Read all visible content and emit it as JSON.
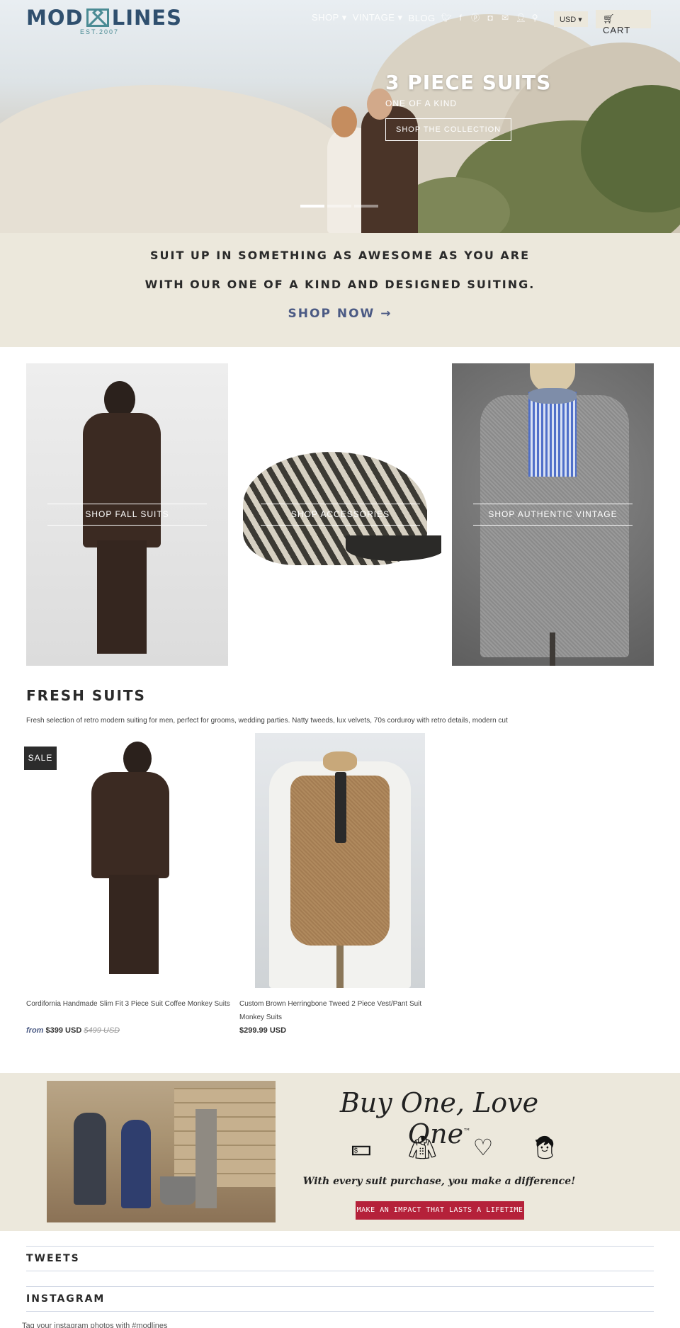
{
  "header": {
    "logo_left": "MOD",
    "logo_right": "LINES",
    "logo_est": "EST.2007",
    "nav": [
      {
        "label": "SHOP",
        "has_dropdown": true
      },
      {
        "label": "VINTAGE",
        "has_dropdown": true
      },
      {
        "label": "BLOG",
        "has_dropdown": false
      }
    ],
    "social_icons": [
      "twitter-icon",
      "facebook-icon",
      "pinterest-icon",
      "instagram-icon",
      "email-icon",
      "account-icon",
      "search-icon"
    ],
    "currency": "USD",
    "cart_label": "CART"
  },
  "hero": {
    "title": "3 PIECE SUITS",
    "subtitle": "ONE OF A KIND",
    "button": "SHOP THE COLLECTION",
    "slides": 3,
    "active_slide": 1
  },
  "banner": {
    "line1": "SUIT UP IN SOMETHING AS AWESOME AS YOU ARE",
    "line2": "WITH OUR ONE OF A KIND AND DESIGNED SUITING.",
    "cta": "SHOP NOW →"
  },
  "collections": [
    {
      "label": "SHOP FALL SUITS"
    },
    {
      "label": "SHOP ACCESSORIES"
    },
    {
      "label": "SHOP AUTHENTIC VINTAGE"
    }
  ],
  "fresh_suits": {
    "title": "FRESH SUITS",
    "description": "Fresh selection of retro modern suiting for men, perfect for grooms, wedding parties. Natty tweeds, lux velvets, 70s corduroy with retro details, modern cut",
    "products": [
      {
        "badge": "SALE",
        "name": "Cordifornia Handmade Slim Fit 3 Piece Suit Coffee Monkey Suits",
        "price_prefix": "from",
        "price": "$399 USD",
        "compare_price": "$499 USD"
      },
      {
        "name": "Custom Brown Herringbone Tweed 2 Piece Vest/Pant Suit Monkey Suits",
        "price": "$299.99 USD"
      }
    ]
  },
  "buy_one_love_one": {
    "title": "Buy One, Love One",
    "trademark": "™",
    "icons": [
      "money-icon",
      "jacket-icon",
      "heart-icon",
      "child-icon"
    ],
    "tagline": "With every suit purchase, you make a difference!",
    "button": "MAKE AN IMPACT THAT LASTS A LIFETIME"
  },
  "footer": {
    "tweets_title": "TWEETS",
    "instagram_title": "INSTAGRAM",
    "instagram_note": "Tag your instagram photos with #modlines"
  },
  "colors": {
    "brand_navy": "#2f4f6e",
    "brand_teal": "#4a8b94",
    "cream": "#ece8dc",
    "link_blue": "#4b5a84",
    "impact_red": "#b5213a"
  }
}
